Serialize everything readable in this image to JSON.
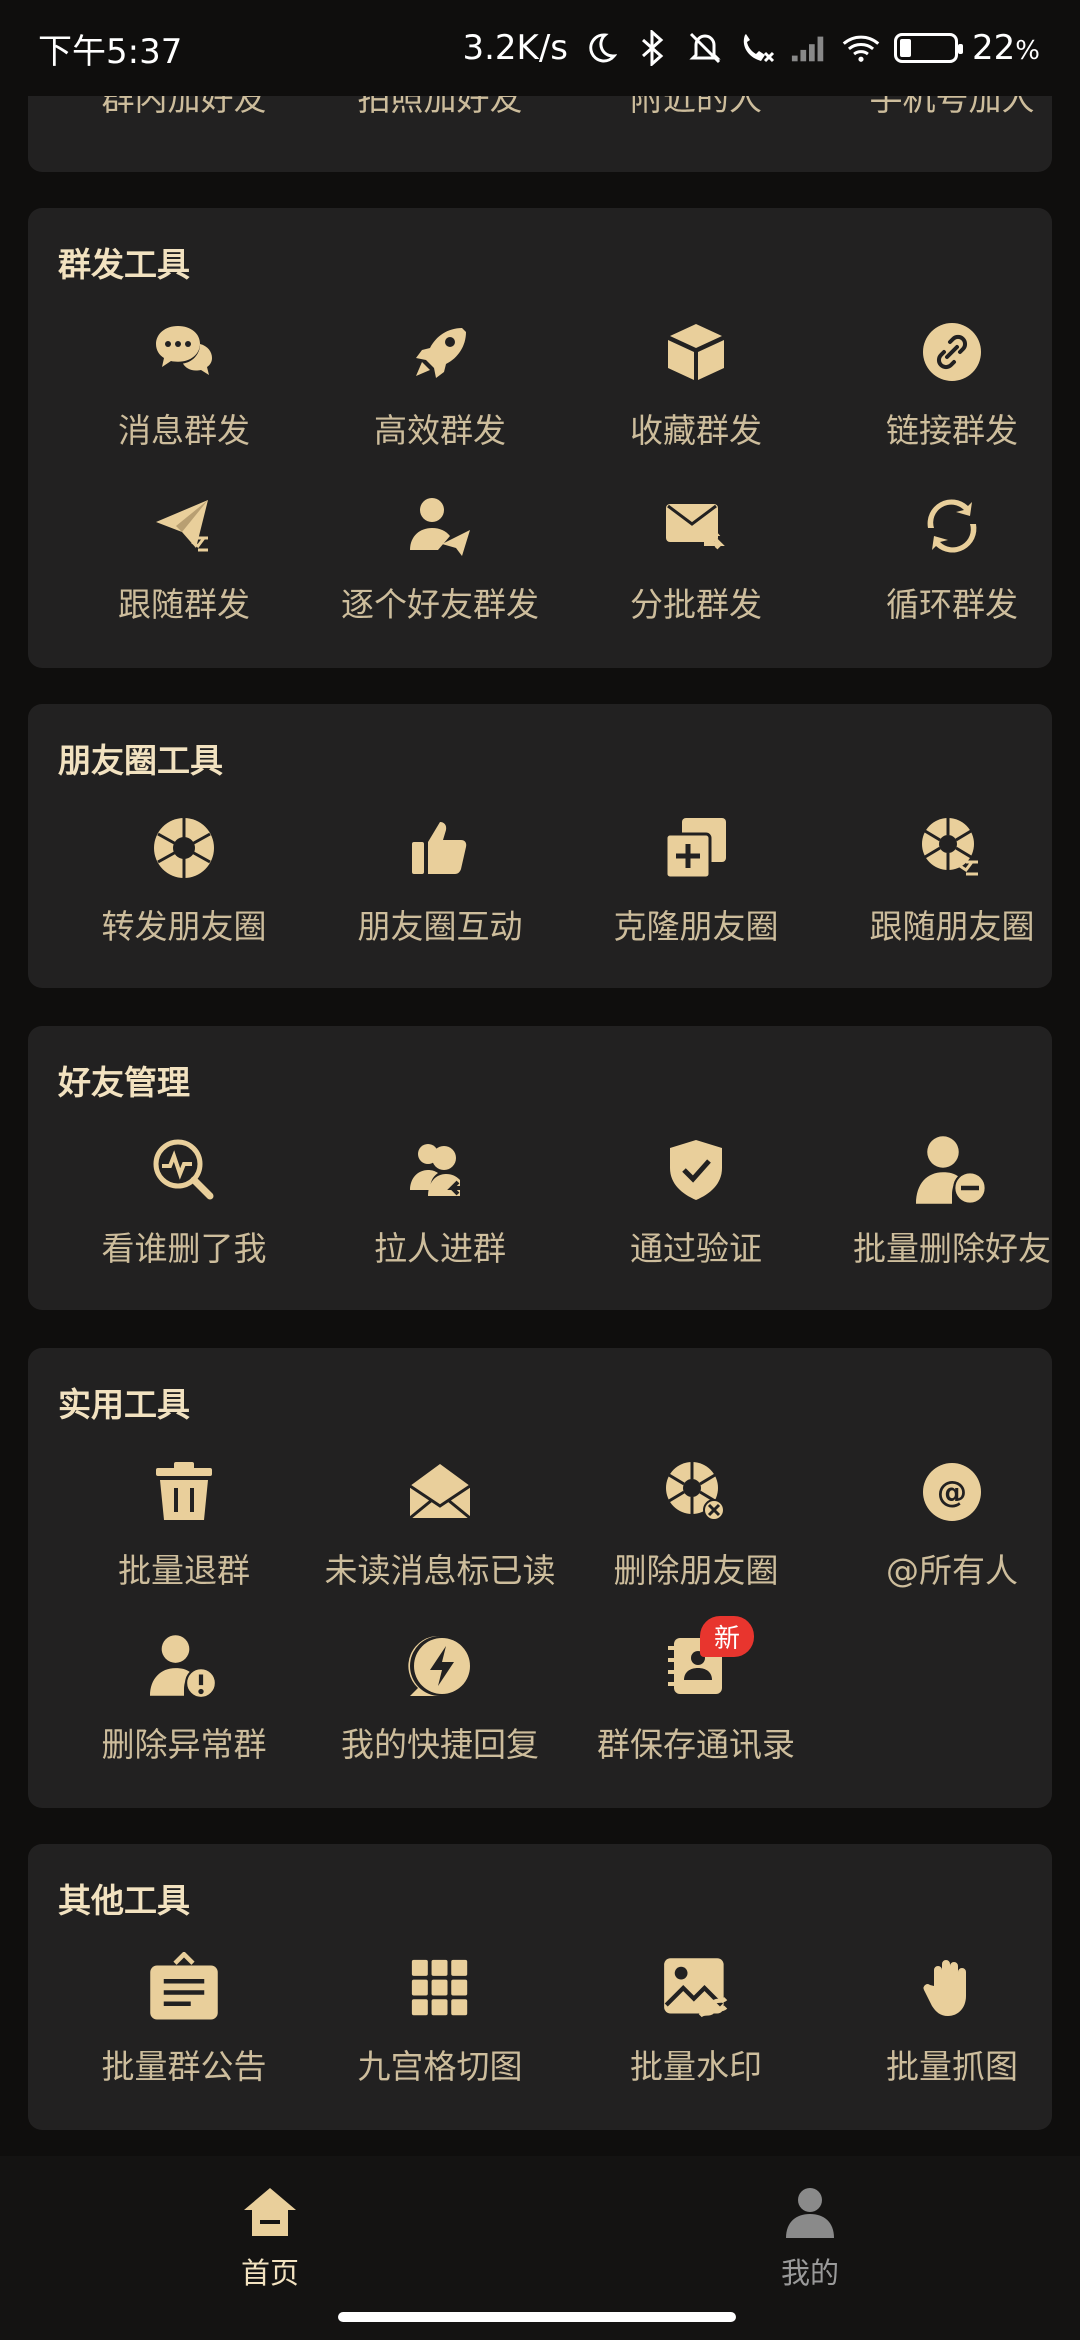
{
  "status_bar": {
    "time": "下午5:37",
    "net_speed": "3.2K/s",
    "battery": "22",
    "battery_unit": "%",
    "battery_level": 0.22,
    "icons": [
      "moon-icon",
      "bluetooth-icon",
      "mute-icon",
      "call-icon",
      "signal-icon",
      "wifi-icon",
      "battery-icon"
    ]
  },
  "top_partial": {
    "items": [
      "群内加好友",
      "拍照加好友",
      "附近的人",
      "手机号加人"
    ]
  },
  "sections": [
    {
      "title": "群发工具",
      "items": [
        {
          "label": "消息群发",
          "icon": "chat-bubbles-icon"
        },
        {
          "label": "高效群发",
          "icon": "rocket-icon"
        },
        {
          "label": "收藏群发",
          "icon": "box-icon"
        },
        {
          "label": "链接群发",
          "icon": "link-icon"
        },
        {
          "label": "跟随群发",
          "icon": "paper-plane-shuffle-icon"
        },
        {
          "label": "逐个好友群发",
          "icon": "user-send-icon"
        },
        {
          "label": "分批群发",
          "icon": "mail-forward-icon"
        },
        {
          "label": "循环群发",
          "icon": "loop-icon"
        }
      ]
    },
    {
      "title": "朋友圈工具",
      "items": [
        {
          "label": "转发朋友圈",
          "icon": "aperture-icon"
        },
        {
          "label": "朋友圈互动",
          "icon": "thumbs-up-icon"
        },
        {
          "label": "克隆朋友圈",
          "icon": "clone-icon"
        },
        {
          "label": "跟随朋友圈",
          "icon": "aperture-shuffle-icon"
        }
      ]
    },
    {
      "title": "好友管理",
      "items": [
        {
          "label": "看谁删了我",
          "icon": "search-pulse-icon"
        },
        {
          "label": "拉人进群",
          "icon": "users-add-icon"
        },
        {
          "label": "通过验证",
          "icon": "shield-check-icon"
        },
        {
          "label": "批量删除好友",
          "icon": "user-remove-icon"
        }
      ]
    },
    {
      "title": "实用工具",
      "items": [
        {
          "label": "批量退群",
          "icon": "trash-icon"
        },
        {
          "label": "未读消息标已读",
          "icon": "envelope-icon"
        },
        {
          "label": "删除朋友圈",
          "icon": "aperture-delete-icon"
        },
        {
          "label": "@所有人",
          "icon": "at-icon"
        },
        {
          "label": "删除异常群",
          "icon": "user-warning-icon"
        },
        {
          "label": "我的快捷回复",
          "icon": "lightning-bubble-icon"
        },
        {
          "label": "群保存通讯录",
          "icon": "contacts-book-icon",
          "badge": "新"
        }
      ]
    },
    {
      "title": "其他工具",
      "items": [
        {
          "label": "批量群公告",
          "icon": "notice-board-icon"
        },
        {
          "label": "九宫格切图",
          "icon": "grid-icon"
        },
        {
          "label": "批量水印",
          "icon": "image-watermark-icon"
        },
        {
          "label": "批量抓图",
          "icon": "hand-grab-icon"
        }
      ]
    }
  ],
  "bottom_nav": {
    "items": [
      {
        "label": "首页",
        "icon": "home-icon",
        "active": true
      },
      {
        "label": "我的",
        "icon": "person-icon",
        "active": false
      }
    ]
  },
  "colors": {
    "background": "#0f0e0d",
    "card": "#222121",
    "icon_gold": "#e9cf9b",
    "label": "#cdbd9c",
    "title": "#f2e2c0",
    "badge": "#e8352e"
  }
}
